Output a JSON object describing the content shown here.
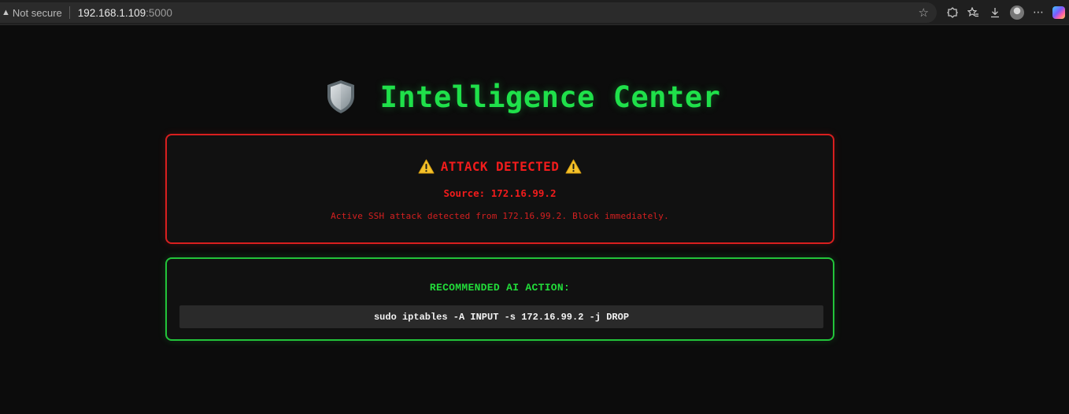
{
  "browser": {
    "security_label": "Not secure",
    "url_host": "192.168.1.109",
    "url_port": ":5000"
  },
  "page": {
    "title": "Intelligence Center",
    "title_color": "#1fe04a"
  },
  "alert": {
    "title": "ATTACK DETECTED",
    "source": "Source: 172.16.99.2",
    "description": "Active SSH attack detected from 172.16.99.2. Block immediately.",
    "color": "#f21c1c"
  },
  "action": {
    "title": "RECOMMENDED AI ACTION:",
    "command": "sudo iptables -A INPUT -s 172.16.99.2 -j DROP",
    "color": "#22dc3a"
  },
  "icons": {
    "shield": "shield-icon",
    "warning": "warning-icon",
    "star": "star-icon",
    "extensions": "extensions-icon",
    "favorites": "favorites-icon",
    "download": "download-icon",
    "profile": "profile-avatar",
    "menu": "more-menu-icon",
    "copilot": "copilot-icon"
  }
}
